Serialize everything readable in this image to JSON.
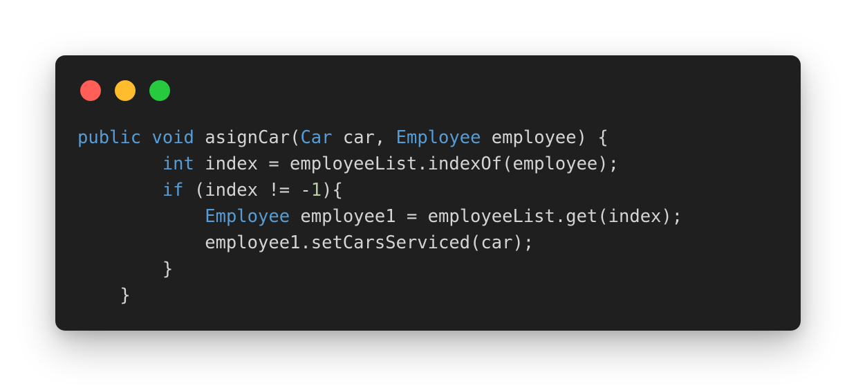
{
  "window": {
    "controls": [
      {
        "name": "close",
        "color": "#ff5f56"
      },
      {
        "name": "minimize",
        "color": "#ffbd2e"
      },
      {
        "name": "maximize",
        "color": "#27c93f"
      }
    ]
  },
  "code": {
    "language": "java",
    "colors": {
      "keyword": "#569cd6",
      "type": "#569cd6",
      "number": "#b5cea8",
      "plain": "#d4d4d4"
    },
    "lines": [
      [
        {
          "t": "keyword",
          "v": "public"
        },
        {
          "t": "plain",
          "v": " "
        },
        {
          "t": "keyword",
          "v": "void"
        },
        {
          "t": "plain",
          "v": " asignCar("
        },
        {
          "t": "type",
          "v": "Car"
        },
        {
          "t": "plain",
          "v": " car, "
        },
        {
          "t": "type",
          "v": "Employee"
        },
        {
          "t": "plain",
          "v": " employee) {"
        }
      ],
      [
        {
          "t": "plain",
          "v": "        "
        },
        {
          "t": "keyword",
          "v": "int"
        },
        {
          "t": "plain",
          "v": " index = employeeList.indexOf(employee);"
        }
      ],
      [
        {
          "t": "plain",
          "v": "        "
        },
        {
          "t": "keyword",
          "v": "if"
        },
        {
          "t": "plain",
          "v": " (index != -"
        },
        {
          "t": "number",
          "v": "1"
        },
        {
          "t": "plain",
          "v": "){"
        }
      ],
      [
        {
          "t": "plain",
          "v": "            "
        },
        {
          "t": "type",
          "v": "Employee"
        },
        {
          "t": "plain",
          "v": " employee1 = employeeList.get(index);"
        }
      ],
      [
        {
          "t": "plain",
          "v": "            employee1.setCarsServiced(car);"
        }
      ],
      [
        {
          "t": "plain",
          "v": "        }"
        }
      ],
      [
        {
          "t": "plain",
          "v": "    }"
        }
      ]
    ]
  }
}
